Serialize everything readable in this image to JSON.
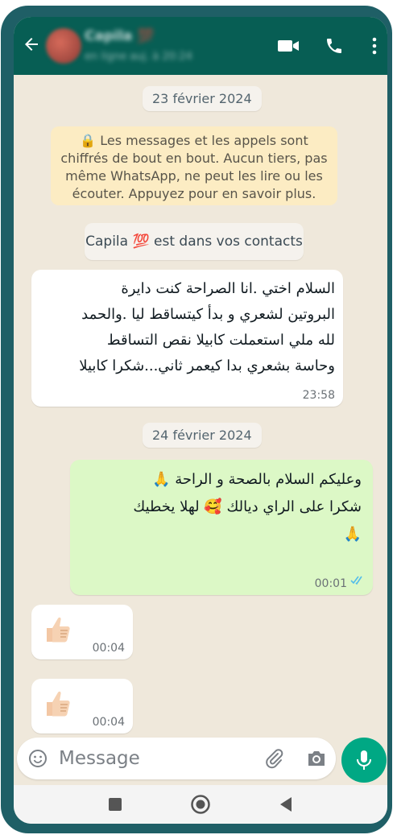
{
  "header": {
    "contact_name": "Capila 💯",
    "status": "en ligne auj. à 20:24"
  },
  "chat": {
    "date_1": "23 février 2024",
    "encryption_lines": [
      "🔒 Les messages et les appels sont",
      "chiffrés de bout en bout. Aucun tiers, pas",
      "même WhatsApp, ne peut les lire ou les",
      "écouter. Appuyez pour en savoir plus."
    ],
    "contact_notice": "Capila 💯 est dans vos contacts",
    "incoming_1": {
      "lines": [
        "السلام اختي .انا الصراحة كنت دايرة",
        "البروتين لشعري و بدأ كيتساقط ليا .والحمد",
        "لله ملي استعملت كابيلا  نقص التساقط",
        "وحاسة بشعري بدا كيعمر ثاني...شكرا كابيلا"
      ],
      "time": "23:58"
    },
    "date_2": "24 février 2024",
    "outgoing_1": {
      "lines": [
        "وعليكم السلام  بالصحة و الراحة 🙏",
        "شكرا على الراي  ديالك 🥰 لهلا يخطيك",
        "🙏"
      ],
      "time": "00:01"
    },
    "incoming_2": {
      "emoji": "👍",
      "time": "00:04"
    },
    "incoming_3": {
      "emoji": "👍",
      "time": "00:04"
    }
  },
  "composer": {
    "placeholder": "Message"
  },
  "colors": {
    "header": "#075e54",
    "chat_background": "#efe8db",
    "outgoing_bubble": "#dcf8c6",
    "mic_button": "#00a884",
    "read_ticks": "#53bdeb"
  }
}
